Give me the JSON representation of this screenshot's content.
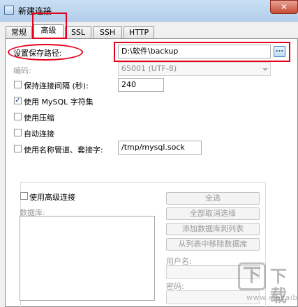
{
  "window": {
    "title": "新建连接",
    "close_glyph": "✕",
    "app_icon": "connection-icon",
    "close_icon": "close-icon"
  },
  "tabs": [
    {
      "label": "常规",
      "active": false
    },
    {
      "label": "高级",
      "active": true
    },
    {
      "label": "SSL",
      "active": false
    },
    {
      "label": "SSH",
      "active": false
    },
    {
      "label": "HTTP",
      "active": false
    }
  ],
  "form": {
    "save_path": {
      "label": "设置保存路径:",
      "value": "D:\\软件\\backup",
      "browse_label": "..."
    },
    "encoding": {
      "label": "编码:",
      "value": "65001 (UTF-8)",
      "dropdown_icon": "chevron-down-icon"
    },
    "keepalive": {
      "label": "保持连接间隔 (秒):",
      "value": "240",
      "checked": false
    },
    "mysql_charset": {
      "label": "使用 MySQL 字符集",
      "checked": true,
      "check_glyph": "✓"
    },
    "compression": {
      "label": "使用压缩",
      "checked": false
    },
    "auto_connect": {
      "label": "自动连接",
      "checked": false
    },
    "named_pipe": {
      "label": "使用名称管道、套接字:",
      "value": "/tmp/mysql.sock",
      "checked": false
    }
  },
  "advanced": {
    "use_advanced": {
      "label": "使用高级连接",
      "checked": false
    },
    "databases_label": "数据库:",
    "buttons": {
      "select_all": "全选",
      "deselect_all": "全部取消选择",
      "add_to_list": "添加数据库到列表",
      "remove_from_list": "从列表中移除数据库"
    },
    "username_label": "用户名:",
    "password_label": "密码:"
  },
  "watermark": {
    "logo": "下",
    "text": "下载",
    "url": "www.xiazaiba.com"
  },
  "colors": {
    "annotation_red": "#e3001b",
    "titlebar": "#b4cfec",
    "close_red": "#c74b36"
  }
}
